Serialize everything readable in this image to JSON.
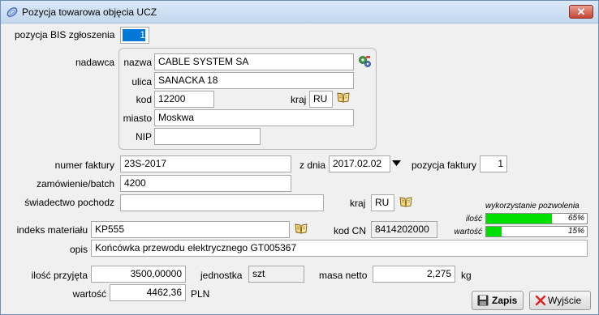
{
  "window": {
    "title": "Pozycja towarowa objęcia UCZ",
    "close": "✕"
  },
  "bis": {
    "label": "pozycja BIS zgłoszenia",
    "value": "1"
  },
  "sender": {
    "label": "nadawca",
    "name_label": "nazwa",
    "name_value": "CABLE SYSTEM SA",
    "street_label": "ulica",
    "street_value": "SANACKA 18",
    "zip_label": "kod",
    "zip_value": "12200",
    "country_label": "kraj",
    "country_value": "RU",
    "city_label": "miasto",
    "city_value": "Moskwa",
    "nip_label": "NIP",
    "nip_value": ""
  },
  "invoice": {
    "number_label": "numer faktury",
    "number_value": "23S-2017",
    "date_label": "z dnia",
    "date_value": "2017.02.02",
    "position_label": "pozycja faktury",
    "position_value": "1"
  },
  "order": {
    "label": "zamówienie/batch",
    "value": "4200"
  },
  "origin": {
    "label": "świadectwo pochodz",
    "value": "",
    "country_label": "kraj",
    "country_value": "RU"
  },
  "permit": {
    "heading": "wykorzystanie pozwolenia",
    "qty_label": "ilość",
    "qty_text": "65%",
    "qty_fraction": 0.65,
    "value_label": "wartość",
    "value_text": "15%",
    "value_fraction": 0.15
  },
  "material": {
    "label": "indeks materiału",
    "value": "KP555",
    "cn_label": "kod CN",
    "cn_value": "8414202000"
  },
  "description": {
    "label": "opis",
    "value": "Końcówka przewodu elektrycznego  GT005367"
  },
  "quantity": {
    "label": "ilość przyjęta",
    "value": "3500,00000",
    "unit_label": "jednostka",
    "unit_value": "szt",
    "mass_label": "masa netto",
    "mass_value": "2,275",
    "mass_unit": "kg"
  },
  "value": {
    "label": "wartość",
    "amount": "4462,36",
    "currency": "PLN"
  },
  "buttons": {
    "save": "Zapis",
    "exit": "Wyjście"
  },
  "colors": {
    "progress": "#00e000",
    "selection": "#0078d7"
  }
}
